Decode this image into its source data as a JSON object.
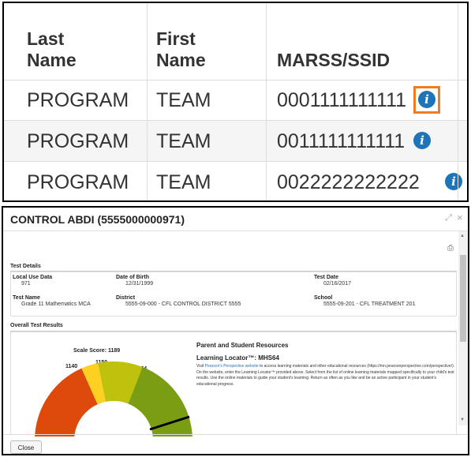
{
  "table": {
    "headers": {
      "last_name_line1": "Last",
      "last_name_line2": "Name",
      "first_name_line1": "First",
      "first_name_line2": "Name",
      "marss": "MARSS/SSID"
    },
    "rows": [
      {
        "last": "PROGRAM",
        "first": "TEAM",
        "marss": "0001111111111"
      },
      {
        "last": "PROGRAM",
        "first": "TEAM",
        "marss": "0011111111111"
      },
      {
        "last": "PROGRAM",
        "first": "TEAM",
        "marss": "0022222222222"
      }
    ],
    "info_icon_glyph": "i",
    "highlight_color": "#f07c1e",
    "info_color": "#1f73b7"
  },
  "modal": {
    "title": "CONTROL ABDI (5555000000971)",
    "expand_glyph": "⤢",
    "close_glyph": "×",
    "print_glyph": "⎙",
    "test_details": {
      "section_title": "Test Details",
      "local_use_label": "Local Use Data",
      "local_use_value": "971",
      "dob_label": "Date of Birth",
      "dob_value": "12/31/1999",
      "test_date_label": "Test Date",
      "test_date_value": "02/16/2017",
      "test_name_label": "Test Name",
      "test_name_value": "Grade 11 Mathematics MCA",
      "district_label": "District",
      "district_value": "5555-09-000 - CFL CONTROL DISTRICT 5555",
      "school_label": "School",
      "school_value": "5555-09-201 - CFL TREATMENT 201"
    },
    "overall": {
      "section_title": "Overall Test Results",
      "scale_score_label": "Scale Score: 1189",
      "tick_1140": "1140",
      "tick_1150": "1150",
      "tick_1164": "1164"
    },
    "resources": {
      "title": "Parent and Student Resources",
      "subtitle": "Learning Locator™: MHS64",
      "text_prefix": "Visit ",
      "link_text": "Pearson's Perspective website",
      "text_body": " to access learning materials and other educational resources (https://mn.pearsonperspective.com/perspective/). On the website, enter the Learning Locator™ provided above. Select from the list of online learning materials mapped specifically to your child's test results. Use the online materials to guide your student's learning. Return as often as you like and be an active participant in your student's educational progress."
    },
    "close_label": "Close"
  }
}
